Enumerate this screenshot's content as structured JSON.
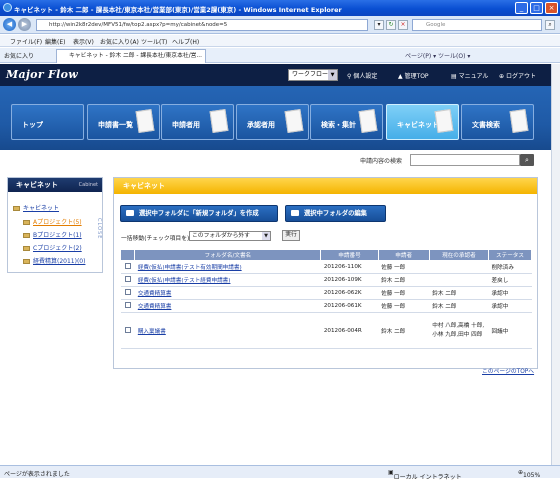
{
  "window": {
    "title": "キャビネット - 鈴木 二郎 - 課長本社/東京本社/営業部(東京)/営業2課(東京) - Windows Internet Explorer"
  },
  "address": {
    "url": "http://win2k8r2dev/MFV51/fw/top2.aspx?p=my/cabinet&node=5",
    "search_placeholder": "Google"
  },
  "menu": [
    "ファイル(F)",
    "編集(E)",
    "表示(V)",
    "お気に入り(A)",
    "ツール(T)",
    "ヘルプ(H)"
  ],
  "favorites": {
    "label": "お気に入り",
    "tab_title": "キャビネット - 鈴木 二郎 - 課長本社/東京本社/営...",
    "tools": "ページ(P) ▾   ツール(O) ▾"
  },
  "app": {
    "logo": "Major Flow",
    "workflow_select": "ワークフロー",
    "links": [
      "個人設定",
      "管理TOP",
      "マニュアル",
      "ログアウト"
    ]
  },
  "nav": [
    "トップ",
    "申請書一覧",
    "申請者用",
    "承認者用",
    "検索・集計",
    "キャビネット",
    "文書検索"
  ],
  "search_label": "申請内容の検索",
  "sidebar": {
    "title": "キャビネット",
    "subtitle": "Cabinet",
    "root": "キャビネット",
    "items": [
      "Aプロジェクト(5)",
      "Bプロジェクト(1)",
      "Cプロジェクト(2)",
      "経費精算(2011)(0)"
    ],
    "close": "CLOSE"
  },
  "main": {
    "title": "キャビネット",
    "btn_create": "選択中フォルダに「新規フォルダ」を作成",
    "btn_edit": "選択中フォルダの編集",
    "bulk_label": "一括移動(チェック項目を)",
    "bulk_option": "このフォルダから外す",
    "exec": "実行",
    "columns": [
      "フォルダ名/文書名",
      "申請番号",
      "申請者",
      "現在の承認者",
      "ステータス"
    ],
    "rows": [
      {
        "name": "経費(仮払)申請書(テスト有効期間申請書)",
        "no": "201206-110K",
        "applicant": "佐藤 一郎",
        "approver": "",
        "status": "削除済み"
      },
      {
        "name": "経費(仮払)申請書(テスト経費申請書)",
        "no": "201206-109K",
        "applicant": "鈴木 二郎",
        "approver": "",
        "status": "差戻し"
      },
      {
        "name": "交通費精算書",
        "no": "201206-062K",
        "applicant": "佐藤 一郎",
        "approver": "鈴木 二郎",
        "status": "承認中"
      },
      {
        "name": "交通費精算書",
        "no": "201206-061K",
        "applicant": "佐藤 一郎",
        "approver": "鈴木 二郎",
        "status": "承認中"
      },
      {
        "name": "購入稟議書",
        "no": "201206-004R",
        "applicant": "鈴木 二郎",
        "approver": "中村 八郎,高橋 十郎,小林 九郎,田中 四郎",
        "status": "回議中"
      }
    ],
    "top_link": "このページのTOPへ"
  },
  "status": {
    "text": "ページが表示されました",
    "zone": "ローカル イントラネット",
    "zoom": "105%"
  }
}
